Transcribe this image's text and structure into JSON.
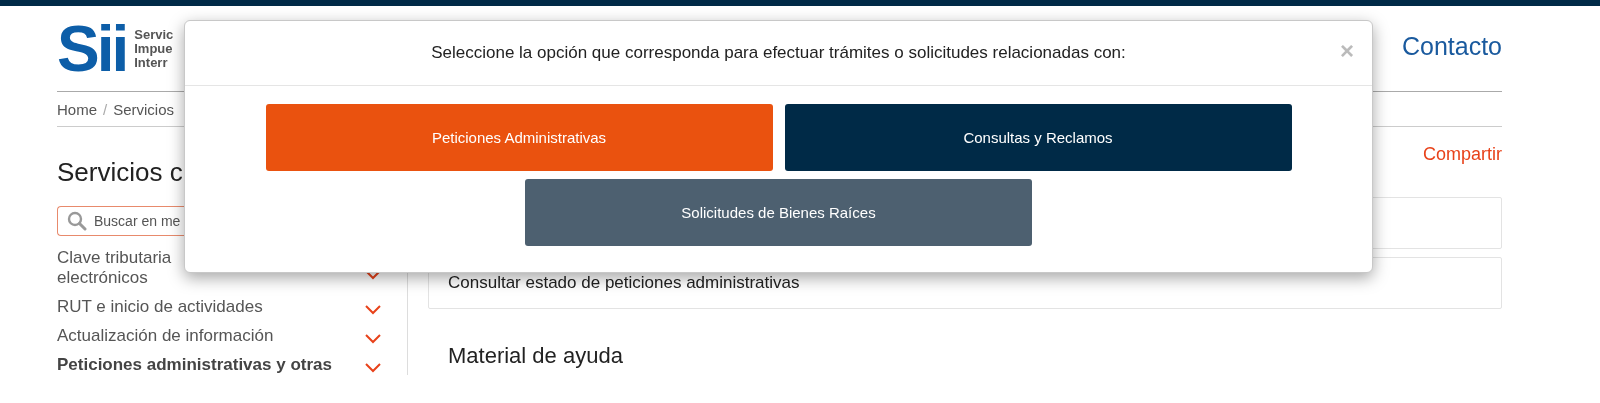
{
  "header": {
    "logo": "Sii",
    "logo_caption": [
      "Servic",
      "Impue",
      "Interr"
    ],
    "contact_link": "Contacto"
  },
  "breadcrumb": {
    "items": [
      "Home",
      "Servicios"
    ],
    "separator": "/"
  },
  "sidebar": {
    "title": "Servicios c",
    "search": {
      "placeholder": "Buscar en me"
    },
    "items": [
      {
        "lines": [
          "Clave tributaria",
          "electrónicos"
        ],
        "bold": false
      },
      {
        "lines": [
          "RUT e inicio de actividades"
        ],
        "bold": false
      },
      {
        "lines": [
          "Actualización de información"
        ],
        "bold": false
      },
      {
        "lines": [
          "Peticiones administrativas y otras"
        ],
        "bold": true
      }
    ]
  },
  "main": {
    "share_link": "Compartir",
    "rows": [
      "",
      "Consultar estado de peticiones administrativas"
    ],
    "section_title": "Material de ayuda"
  },
  "modal": {
    "title": "Seleccione la opción que corresponda para efectuar trámites o solicitudes relacionadas con:",
    "close": "×",
    "buttons": [
      {
        "label": "Peticiones Administrativas",
        "color": "#ea520f"
      },
      {
        "label": "Consultas y Reclamos",
        "color": "#002a47"
      },
      {
        "label": "Solicitudes de Bienes Raíces",
        "color": "#4d6070"
      }
    ]
  }
}
